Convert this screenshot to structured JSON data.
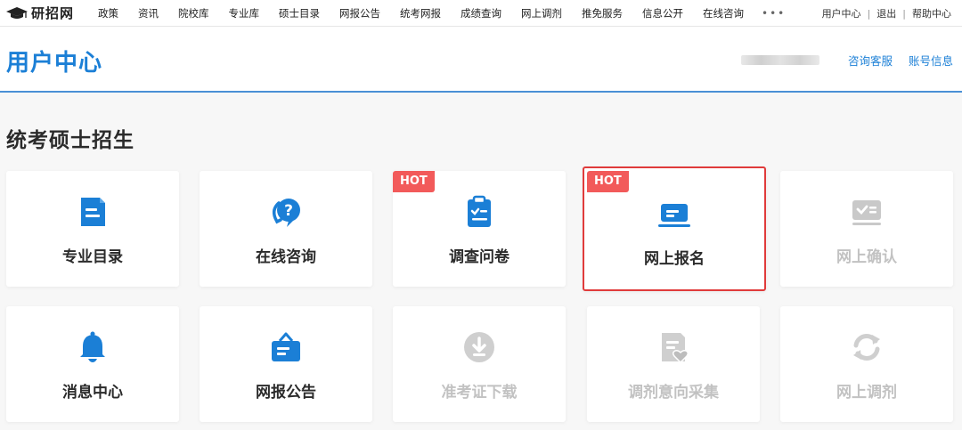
{
  "topnav": {
    "logo_text": "研招网",
    "items": [
      "政策",
      "资讯",
      "院校库",
      "专业库",
      "硕士目录",
      "网报公告",
      "统考网报",
      "成绩查询",
      "网上调剂",
      "推免服务",
      "信息公开",
      "在线咨询"
    ],
    "more": "•••",
    "right": {
      "user_center": "用户中心",
      "logout": "退出",
      "help": "帮助中心"
    }
  },
  "header": {
    "title": "用户中心",
    "links": {
      "consult": "咨询客服",
      "account": "账号信息"
    }
  },
  "section": {
    "title": "统考硕士招生"
  },
  "badge": "HOT",
  "cards": [
    {
      "label": "专业目录",
      "icon": "document-icon",
      "state": "active",
      "hot": false
    },
    {
      "label": "在线咨询",
      "icon": "question-chat-icon",
      "state": "active",
      "hot": false
    },
    {
      "label": "调查问卷",
      "icon": "clipboard-check-icon",
      "state": "active",
      "hot": true
    },
    {
      "label": "网上报名",
      "icon": "laptop-icon",
      "state": "selected",
      "hot": true
    },
    {
      "label": "网上确认",
      "icon": "id-card-check-icon",
      "state": "disabled",
      "hot": false
    },
    {
      "label": "消息中心",
      "icon": "bell-icon",
      "state": "active",
      "hot": false
    },
    {
      "label": "网报公告",
      "icon": "notice-board-icon",
      "state": "active",
      "hot": false
    },
    {
      "label": "准考证下载",
      "icon": "download-icon",
      "state": "disabled",
      "hot": false
    },
    {
      "label": "调剂意向采集",
      "icon": "document-heart-icon",
      "state": "disabled",
      "hot": false
    },
    {
      "label": "网上调剂",
      "icon": "refresh-icon",
      "state": "disabled",
      "hot": false
    }
  ],
  "colors": {
    "primary": "#1b7fd6",
    "hot": "#f25a5a",
    "selected_border": "#e03b3b",
    "disabled": "#c2c2c2"
  }
}
